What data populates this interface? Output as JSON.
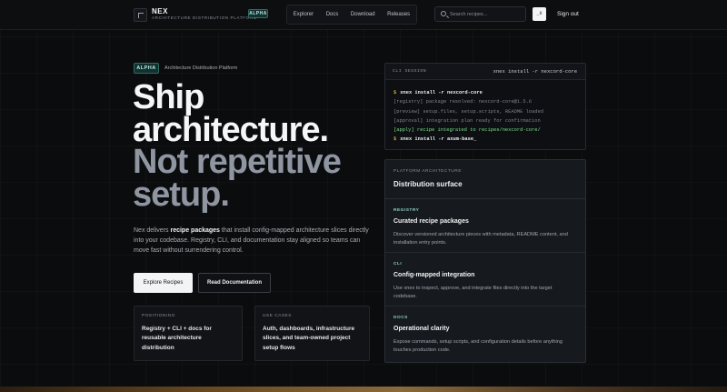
{
  "header": {
    "brand_name": "NEX",
    "brand_subtitle": "ARCHITECTURE DISTRIBUTION PLATFORM",
    "badge": "ALPHA",
    "nav": [
      "Explorer",
      "Docs",
      "Download",
      "Releases"
    ],
    "search_placeholder": "Search recipes...",
    "search_shortcut": "_9",
    "sign_out": "Sign out"
  },
  "hero": {
    "badge": "ALPHA",
    "eyebrow": "Architecture Distribution Platform",
    "headline": [
      "Ship",
      "architecture.",
      "Not repetitive",
      "setup."
    ],
    "lead_pre": "Nex delivers ",
    "lead_bold": "recipe packages",
    "lead_post": " that install config-mapped architecture slices directly into your codebase. Registry, CLI, and documentation stay aligned so teams can move fast without surrendering control.",
    "primary_button": "Explore Recipes",
    "secondary_button": "Read Documentation",
    "cards": [
      {
        "label": "POSITIONING",
        "text": "Registry + CLI + docs for reusable architecture distribution"
      },
      {
        "label": "USE CASES",
        "text": "Auth, dashboards, infrastructure slices, and team-owned project setup flows"
      }
    ]
  },
  "terminal": {
    "title": "CLI SESSION",
    "command": "xnex install -r nexcord-core",
    "lines": [
      {
        "type": "cmd",
        "prompt": "$",
        "text": "xnex install -r nexcord-core"
      },
      {
        "type": "log",
        "text": "[registry] package resolved: nexcord-core@1.5.6"
      },
      {
        "type": "log",
        "text": "[preview] setup.files, setup.scripts, README loaded"
      },
      {
        "type": "log",
        "text": "[approval] integration plan ready for confirmation"
      },
      {
        "type": "success",
        "text": "[apply] recipe integrated to recipes/nexcord-core/"
      },
      {
        "type": "cmd",
        "prompt": "$",
        "text": "xnex install -r axum-base_"
      }
    ]
  },
  "surface": {
    "label": "PLATFORM ARCHITECTURE",
    "title": "Distribution surface",
    "items": [
      {
        "kicker": "REGISTRY",
        "title": "Curated recipe packages",
        "desc": "Discover versioned architecture pieces with metadata, README content, and installation entry points."
      },
      {
        "kicker": "CLI",
        "title": "Config-mapped integration",
        "desc": "Use xnex to inspect, approve, and integrate files directly into the target codebase."
      },
      {
        "kicker": "DOCS",
        "title": "Operational clarity",
        "desc": "Expose commands, setup scripts, and configuration details before anything touches production code."
      }
    ]
  },
  "colors": {
    "background": "#0b0c0e",
    "accent_teal": "#8fd3c8",
    "prompt_yellow": "#f2d24f",
    "success_green": "#7be08a"
  }
}
